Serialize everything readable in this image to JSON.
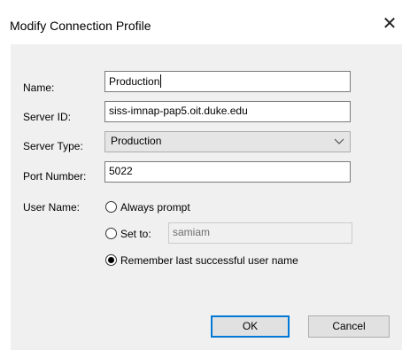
{
  "dialog": {
    "title": "Modify Connection Profile",
    "close_glyph": "✕"
  },
  "form": {
    "name_label": "Name:",
    "name_value": "Production",
    "server_id_label": "Server ID:",
    "server_id_value": "siss-imnap-pap5.oit.duke.edu",
    "server_type_label": "Server Type:",
    "server_type_value": "Production",
    "port_label": "Port Number:",
    "port_value": "5022",
    "user_name_label": "User Name:",
    "radio_always_prompt": "Always prompt",
    "radio_set_to": "Set to:",
    "set_to_value": "samiam",
    "radio_remember": "Remember last successful user name",
    "selected_radio": "remember"
  },
  "buttons": {
    "ok_label": "OK",
    "cancel_label": "Cancel"
  },
  "colors": {
    "dialog_bg": "#f0f0f0",
    "title_bg": "#ffffff",
    "default_button_border": "#0078d7"
  }
}
